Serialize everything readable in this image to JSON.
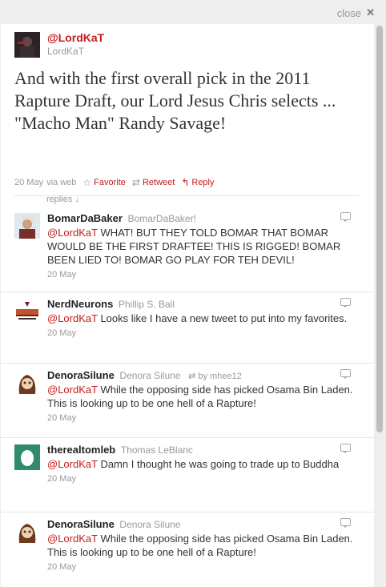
{
  "close": {
    "label": "close",
    "icon": "close-icon"
  },
  "main_tweet": {
    "screen_name": "@LordKaT",
    "name": "LordKaT",
    "text": "And with the first overall pick in the 2011 Rapture Draft, our Lord Jesus Chris selects ... \"Macho Man\" Randy Savage!",
    "date": "20 May",
    "via": "via web",
    "favorite": "Favorite",
    "retweet": "Retweet",
    "reply": "Reply"
  },
  "replies_label": "replies ↓",
  "replies": [
    {
      "screen_name": "BomarDaBaker",
      "name": "BomarDaBaker!",
      "mention": "@LordKaT",
      "text": " WHAT! BUT THEY TOLD BOMAR THAT BOMAR WOULD BE THE FIRST DRAFTEE! THIS IS RIGGED! BOMAR BEEN LIED TO! BOMAR GO PLAY FOR TEH DEVIL!",
      "date": "20 May",
      "retweeted_by": ""
    },
    {
      "screen_name": "NerdNeurons",
      "name": "Phillip S. Ball",
      "mention": "@LordKaT",
      "text": " Looks like I have a new tweet to put into my favorites.",
      "date": "20 May",
      "retweeted_by": ""
    },
    {
      "screen_name": "DenoraSilune",
      "name": "Denora Silune",
      "mention": "@LordKaT",
      "text": " While the opposing side has picked Osama Bin Laden. This is looking up to be one hell of a Rapture!",
      "date": "20 May",
      "retweeted_by": "by mhee12"
    },
    {
      "screen_name": "therealtomleb",
      "name": "Thomas LeBlanc",
      "mention": "@LordKaT",
      "text": " Damn I thought he was going to trade up to Buddha",
      "date": "20 May",
      "retweeted_by": ""
    },
    {
      "screen_name": "DenoraSilune",
      "name": "Denora Silune",
      "mention": "@LordKaT",
      "text": " While the opposing side has picked Osama Bin Laden. This is looking up to be one hell of a Rapture!",
      "date": "20 May",
      "retweeted_by": ""
    }
  ],
  "colors": {
    "accent": "#c41c1c",
    "muted": "#999999",
    "text": "#333333"
  }
}
